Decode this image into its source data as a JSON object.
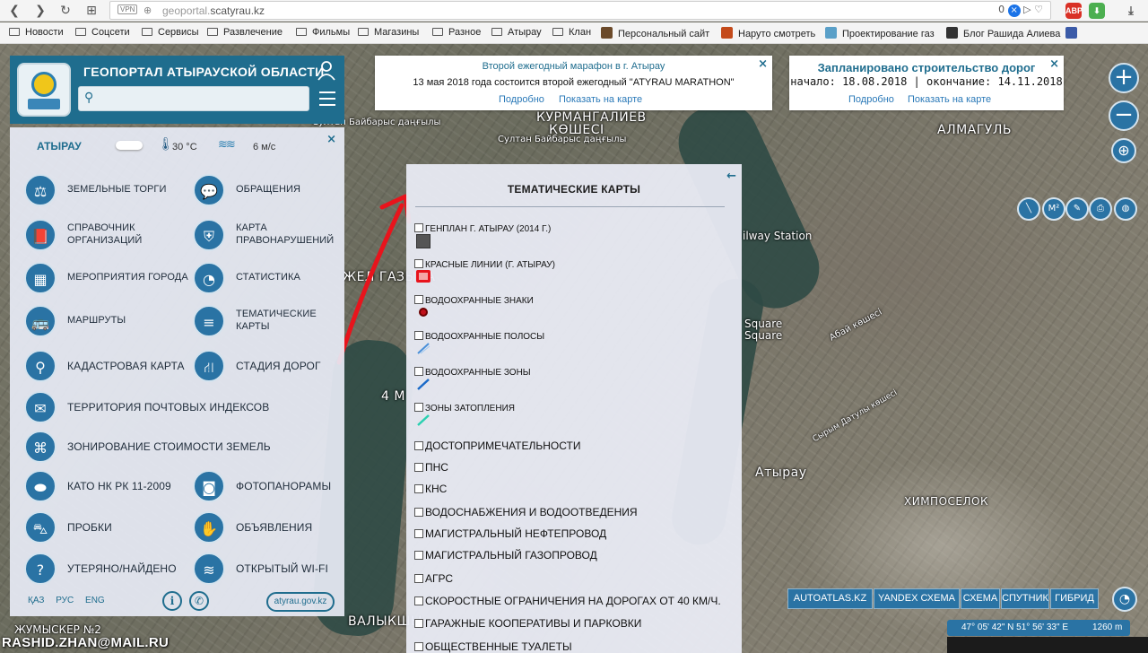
{
  "browser": {
    "url_prefix": "geoportal.",
    "url_domain": "scatyrau.kz",
    "vpn_label": "VPN",
    "badge_count": "0",
    "bookmarks": [
      {
        "label": "Новости",
        "type": "folder"
      },
      {
        "label": "Соцсети",
        "type": "folder"
      },
      {
        "label": "Сервисы",
        "type": "folder"
      },
      {
        "label": "Развлечение",
        "type": "folder"
      },
      {
        "label": "Фильмы",
        "type": "folder"
      },
      {
        "label": "Магазины",
        "type": "folder"
      },
      {
        "label": "Разное",
        "type": "folder"
      },
      {
        "label": "Атырау",
        "type": "folder"
      },
      {
        "label": "Клан",
        "type": "folder"
      },
      {
        "label": "Персональный сайт",
        "type": "favicon"
      },
      {
        "label": "Наруто смотреть",
        "type": "favicon"
      },
      {
        "label": "Проектирование газ",
        "type": "favicon"
      },
      {
        "label": "Блог Рашида Алиева",
        "type": "favicon"
      }
    ]
  },
  "header": {
    "title": "ГЕОПОРТАЛ АТЫРАУСКОЙ ОБЛАСТИ",
    "search_placeholder": ""
  },
  "weather": {
    "city": "АТЫРАУ",
    "temperature": "30 °С",
    "wind": "6 м/с"
  },
  "menu": {
    "items": [
      {
        "label": "ЗЕМЕЛЬНЫЕ ТОРГИ",
        "icon": "gavel-icon"
      },
      {
        "label": "ОБРАЩЕНИЯ",
        "icon": "chat-bubbles-icon"
      },
      {
        "label": "СПРАВОЧНИК\nОРГАНИЗАЦИЙ",
        "icon": "book-icon"
      },
      {
        "label": "КАРТА\nПРАВОНАРУШЕНИЙ",
        "icon": "shield-icon"
      },
      {
        "label": "МЕРОПРИЯТИЯ ГОРОДА",
        "icon": "building-icon"
      },
      {
        "label": "СТАТИСТИКА",
        "icon": "pie-chart-icon"
      },
      {
        "label": "МАРШРУТЫ",
        "icon": "bus-icon"
      },
      {
        "label": "ТЕМАТИЧЕСКИЕ\nКАРТЫ",
        "icon": "layers-icon"
      },
      {
        "label": "КАДАСТРОВАЯ КАРТА",
        "icon": "map-pin-icon"
      },
      {
        "label": "СТАДИЯ ДОРОГ",
        "icon": "road-icon"
      },
      {
        "label": "ТЕРРИТОРИЯ ПОЧТОВЫХ ИНДЕКСОВ",
        "icon": "envelope-icon"
      },
      {
        "label": "ЗОНИРОВАНИЕ СТОИМОСТИ ЗЕМЕЛЬ",
        "icon": "tag-icon"
      },
      {
        "label": "КАТО НК РК 11-2009",
        "icon": "kazakhstan-map-icon"
      },
      {
        "label": "ФОТОПАНОРАМЫ",
        "icon": "camera-icon"
      },
      {
        "label": "ПРОБКИ",
        "icon": "car-icon"
      },
      {
        "label": "ОБЪЯВЛЕНИЯ",
        "icon": "handshake-icon"
      },
      {
        "label": "УТЕРЯНО/НАЙДЕНО",
        "icon": "question-icon"
      },
      {
        "label": "ОТКРЫТЫЙ WI-FI",
        "icon": "wifi-icon"
      }
    ]
  },
  "footer": {
    "languages": [
      "ҚАЗ",
      "РУС",
      "ENG"
    ],
    "info_label": "i",
    "phone_label": "✆",
    "site_link": "atyrau.gov.kz"
  },
  "notifications": {
    "marathon": {
      "title": "Второй ежегодный марафон в г. Атырау",
      "text": "13 мая 2018 года состоится второй ежегодный \"ATYRAU MARATHON\"",
      "more": "Подробно",
      "show_map": "Показать на карте"
    },
    "roads": {
      "title": "Запланировано строительство дорог",
      "text": "начало: 18.08.2018 | окончание: 14.11.2018",
      "more": "Подробно",
      "show_map": "Показать на карте"
    }
  },
  "thematic": {
    "title": "ТЕМАТИЧЕСКИЕ КАРТЫ",
    "layers": [
      {
        "label": "ГЕНПЛАН Г. АТЫРАУ (2014 Г.)",
        "symbol": "gray-square"
      },
      {
        "label": "КРАСНЫЕ ЛИНИИ (Г. АТЫРАУ)",
        "symbol": "red-square"
      },
      {
        "label": "ВОДООХРАННЫЕ ЗНАКИ",
        "symbol": "red-dot"
      },
      {
        "label": "ВОДООХРАННЫЕ ПОЛОСЫ",
        "symbol": "hatched-line"
      },
      {
        "label": "ВОДООХРАННЫЕ ЗОНЫ",
        "symbol": "blue-line"
      },
      {
        "label": "ЗОНЫ ЗАТОПЛЕНИЯ",
        "symbol": "teal-line"
      },
      {
        "label": "ДОСТОПРИМЕЧАТЕЛЬНОСТИ"
      },
      {
        "label": "ПНС"
      },
      {
        "label": "КНС"
      },
      {
        "label": "ВОДОСНАБЖЕНИЯ И ВОДООТВЕДЕНИЯ"
      },
      {
        "label": "МАГИСТРАЛЬНЫЙ НЕФТЕПРОВОД"
      },
      {
        "label": "МАГИСТРАЛЬНЫЙ ГАЗОПРОВОД"
      },
      {
        "label": "АГРС"
      },
      {
        "label": "СКОРОСТНЫЕ ОГРАНИЧЕНИЯ НА ДОРОГАХ ОТ 40 КМ/Ч."
      },
      {
        "label": "ГАРАЖНЫЕ КООПЕРАТИВЫ И ПАРКОВКИ"
      },
      {
        "label": "ОБЩЕСТВЕННЫЕ ТУАЛЕТЫ"
      }
    ]
  },
  "map": {
    "labels": {
      "kurmangaliev": "КУРМАНГАЛИЕВ",
      "koshesi": "КӨШЕСІ",
      "sultan_1": "Султан Байбарыс даңғылы",
      "sultan_2": "Султан Байбарыс даңғылы",
      "almagul": "АЛМАГУЛЬ",
      "railway": "ilway Station",
      "square_1": "Square",
      "square_2": "Square",
      "abai": "Абай көшесі",
      "atyrau_city": "Атырау",
      "khimposelok": "ХИМПОСЕЛОК",
      "zhumysker": "ЖУМЫСКЕР №2",
      "valykshy": "ВАЛЫКШЫ",
      "zhylgorodok": "ЖЕЛ ГАЗЫНА",
      "four_m": "4 М",
      "syrym": "Сырым Датулы көшесі"
    },
    "zoom_in": "+",
    "zoom_out": "−",
    "tools": [
      "ruler-icon",
      "M²",
      "pencil-icon",
      "print-icon",
      "globe-icon"
    ],
    "map_types": [
      "AUTOATLAS.KZ",
      "YANDEX СХЕМА",
      "СХЕМА",
      "СПУТНИК",
      "ГИБРИД"
    ],
    "coordinates": "47° 05' 42\" N 51° 56' 33\" E",
    "scale": "1260 m"
  },
  "watermark": "RASHID.ZHAN@MAIL.RU",
  "colors": {
    "header": "#1f6d8e",
    "accent": "#2a73a4",
    "arrow": "#e8141c"
  }
}
